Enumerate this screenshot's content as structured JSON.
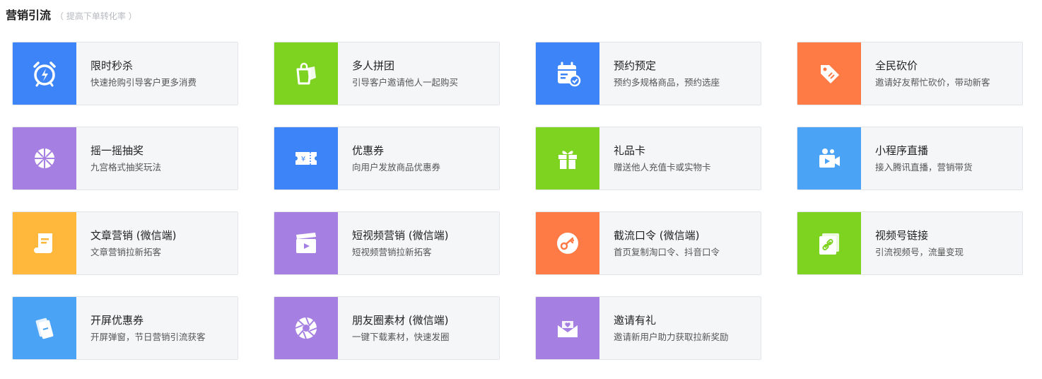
{
  "header": {
    "title": "营销引流",
    "subtitle": "（ 提高下单转化率 ）"
  },
  "colors": {
    "blue": "#3c84f8",
    "green": "#7ed321",
    "orange": "#ff7b45",
    "purple": "#a57fe2",
    "yellow": "#ffb83c",
    "skyblue": "#4aa3f5"
  },
  "cards": [
    {
      "name": "限时秒杀",
      "desc": "快速抢购引导客户更多消费",
      "icon": "alarm-clock-icon",
      "color": "#3c84f8"
    },
    {
      "name": "多人拼团",
      "desc": "引导客户邀请他人一起购买",
      "icon": "shopping-bag-icon",
      "color": "#7ed321"
    },
    {
      "name": "预约预定",
      "desc": "预约多规格商品，预约选座",
      "icon": "calendar-check-icon",
      "color": "#3c84f8"
    },
    {
      "name": "全民砍价",
      "desc": "邀请好友帮忙砍价，带动新客",
      "icon": "price-tag-icon",
      "color": "#ff7b45"
    },
    {
      "name": "摇一摇抽奖",
      "desc": "九宫格式抽奖玩法",
      "icon": "lottery-wheel-icon",
      "color": "#a57fe2"
    },
    {
      "name": "优惠券",
      "desc": "向用户发放商品优惠券",
      "icon": "coupon-icon",
      "color": "#3c84f8"
    },
    {
      "name": "礼品卡",
      "desc": "赠送他人充值卡或实物卡",
      "icon": "gift-icon",
      "color": "#7ed321"
    },
    {
      "name": "小程序直播",
      "desc": "接入腾讯直播，营销带货",
      "icon": "video-camera-icon",
      "color": "#4aa3f5"
    },
    {
      "name": "文章营销 (微信端)",
      "desc": "文章营销拉新拓客",
      "icon": "scroll-icon",
      "color": "#ffb83c"
    },
    {
      "name": "短视频营销 (微信端)",
      "desc": "短视频营销拉新拓客",
      "icon": "clapperboard-icon",
      "color": "#a57fe2"
    },
    {
      "name": "截流口令 (微信端)",
      "desc": "首页复制淘口令、抖音口令",
      "icon": "key-icon",
      "color": "#ff7b45"
    },
    {
      "name": "视频号链接",
      "desc": "引流视频号，流量变现",
      "icon": "link-icon",
      "color": "#7ed321"
    },
    {
      "name": "开屏优惠券",
      "desc": "开屏弹窗，节日营销引流获客",
      "icon": "ticket-cards-icon",
      "color": "#4aa3f5"
    },
    {
      "name": "朋友圈素材 (微信端)",
      "desc": "一键下载素材，快速发圈",
      "icon": "aperture-icon",
      "color": "#a57fe2"
    },
    {
      "name": "邀请有礼",
      "desc": "邀请新用户助力获取拉新奖励",
      "icon": "invite-envelope-icon",
      "color": "#a57fe2"
    }
  ]
}
